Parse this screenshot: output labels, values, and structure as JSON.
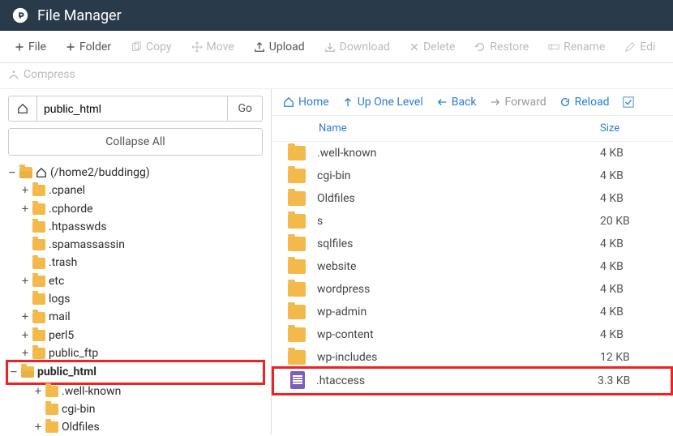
{
  "header": {
    "title": "File Manager"
  },
  "toolbar": {
    "file": "File",
    "folder": "Folder",
    "copy": "Copy",
    "move": "Move",
    "upload": "Upload",
    "download": "Download",
    "delete": "Delete",
    "restore": "Restore",
    "rename": "Rename",
    "edit": "Edi",
    "compress": "Compress"
  },
  "sidebar": {
    "path_value": "public_html",
    "go": "Go",
    "collapse": "Collapse All",
    "root": "(/home2/buddingg)",
    "nodes": [
      {
        "label": ".cpanel",
        "toggle": "+",
        "indent": 1
      },
      {
        "label": ".cphorde",
        "toggle": "+",
        "indent": 1
      },
      {
        "label": ".htpasswds",
        "toggle": "",
        "indent": 1
      },
      {
        "label": ".spamassassin",
        "toggle": "",
        "indent": 1
      },
      {
        "label": ".trash",
        "toggle": "",
        "indent": 1
      },
      {
        "label": "etc",
        "toggle": "+",
        "indent": 1
      },
      {
        "label": "logs",
        "toggle": "",
        "indent": 1
      },
      {
        "label": "mail",
        "toggle": "+",
        "indent": 1
      },
      {
        "label": "perl5",
        "toggle": "+",
        "indent": 1
      },
      {
        "label": "public_ftp",
        "toggle": "+",
        "indent": 1
      },
      {
        "label": "public_html",
        "toggle": "−",
        "indent": 1,
        "open": true,
        "highlight": true
      },
      {
        "label": ".well-known",
        "toggle": "+",
        "indent": 2
      },
      {
        "label": "cgi-bin",
        "toggle": "",
        "indent": 2
      },
      {
        "label": "Oldfiles",
        "toggle": "+",
        "indent": 2
      }
    ]
  },
  "content_toolbar": {
    "home": "Home",
    "up": "Up One Level",
    "back": "Back",
    "forward": "Forward",
    "reload": "Reload"
  },
  "table": {
    "head": {
      "name": "Name",
      "size": "Size"
    },
    "rows": [
      {
        "name": ".well-known",
        "size": "4 KB",
        "type": "folder"
      },
      {
        "name": "cgi-bin",
        "size": "4 KB",
        "type": "folder"
      },
      {
        "name": "Oldfiles",
        "size": "4 KB",
        "type": "folder"
      },
      {
        "name": "s",
        "size": "20 KB",
        "type": "folder"
      },
      {
        "name": "sqlfiles",
        "size": "4 KB",
        "type": "folder"
      },
      {
        "name": "website",
        "size": "4 KB",
        "type": "folder"
      },
      {
        "name": "wordpress",
        "size": "4 KB",
        "type": "folder"
      },
      {
        "name": "wp-admin",
        "size": "4 KB",
        "type": "folder"
      },
      {
        "name": "wp-content",
        "size": "4 KB",
        "type": "folder"
      },
      {
        "name": "wp-includes",
        "size": "12 KB",
        "type": "folder"
      },
      {
        "name": ".htaccess",
        "size": "3.3 KB",
        "type": "file",
        "highlight": true
      }
    ]
  }
}
